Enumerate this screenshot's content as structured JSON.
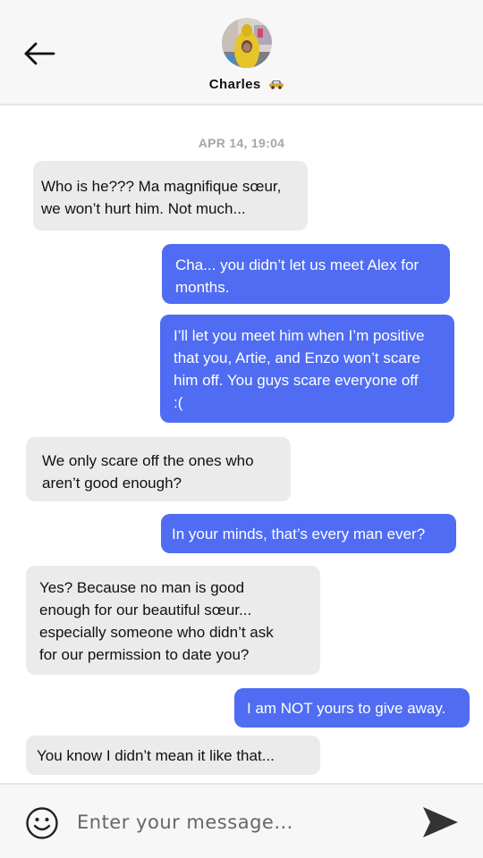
{
  "header": {
    "contact_name": "Charles",
    "name_badge_icon": "car-emoji-icon",
    "back_icon": "arrow-left-icon",
    "avatar_icon": "avatar"
  },
  "conversation": {
    "timestamp": "APR 14, 19:04",
    "messages": [
      {
        "direction": "incoming",
        "lines": [
          "Who is he??? Ma magnifique sœur,",
          "we won’t hurt him. Not much..."
        ]
      },
      {
        "direction": "outgoing",
        "lines": [
          "Cha... you didn’t let us meet Alex for",
          "months."
        ]
      },
      {
        "direction": "outgoing",
        "lines": [
          "I’ll let you meet him when I’m positive",
          "that you, Artie, and Enzo won’t scare",
          "him off. You guys scare everyone off",
          ":("
        ]
      },
      {
        "direction": "incoming",
        "lines": [
          "We only scare off the ones who",
          "aren’t good enough?"
        ]
      },
      {
        "direction": "outgoing",
        "lines": [
          "In your minds, that’s every man ever?"
        ]
      },
      {
        "direction": "incoming",
        "lines": [
          "Yes? Because no man is good",
          "enough for our beautiful sœur...",
          "especially someone who didn’t ask",
          "for our permission to date you?"
        ]
      },
      {
        "direction": "outgoing",
        "lines": [
          "I am NOT yours to give away."
        ]
      },
      {
        "direction": "incoming",
        "lines": [
          "You know I didn’t mean it like that..."
        ]
      }
    ]
  },
  "composer": {
    "placeholder": "Enter your message...",
    "value": "",
    "emoji_icon": "smiley-icon",
    "send_icon": "send-icon"
  },
  "colors": {
    "outgoing_bubble": "#4f6cf2",
    "incoming_bubble": "#ebebeb",
    "header_bg": "#f7f7f7",
    "timestamp": "#a6a6a6"
  }
}
